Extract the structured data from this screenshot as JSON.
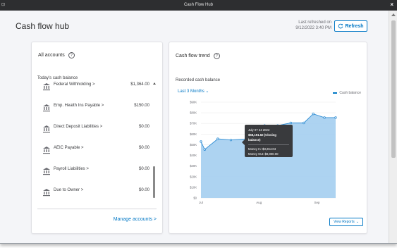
{
  "window": {
    "title": "Cash Flow Hub",
    "left_icon": "⊡",
    "close_icon": "×"
  },
  "header": {
    "page_title": "Cash flow hub",
    "last_refreshed_label": "Last refreshed on",
    "last_refreshed_value": "9/12/2022 3:40 PM",
    "refresh_label": "Refresh",
    "refresh_icon": "refresh-icon"
  },
  "accounts_card": {
    "title": "All accounts",
    "help_icon": "?",
    "section_label": "Today's cash balance",
    "accounts": [
      {
        "name": "Federal Withholding",
        "chevron": ">",
        "amount": "$1,364.00"
      },
      {
        "name": "Emp. Health Ins Payable",
        "chevron": ">",
        "amount": "$150.00"
      },
      {
        "name": "Direct Deposit Liabilities",
        "chevron": ">",
        "amount": "$0.00"
      },
      {
        "name": "AEIC Payable",
        "chevron": ">",
        "amount": "$0.00"
      },
      {
        "name": "Payroll Liabilities",
        "chevron": ">",
        "amount": "$0.00"
      },
      {
        "name": "Due to Owner",
        "chevron": ">",
        "amount": "$0.00"
      }
    ],
    "account_icon": "bank-icon",
    "manage_link": "Manage accounts >"
  },
  "trend_card": {
    "title": "Cash flow trend",
    "help_icon": "?",
    "recorded_label": "Recorded cash balance",
    "period_select": "Last 3 Months",
    "legend_label": "Cash balance",
    "view_reports": "View Reports",
    "tooltip": {
      "date": "July 07 24 2022",
      "balance_line": "$58,191.62 (Closing balance)",
      "money_in": "Money In: $3,264.04",
      "money_out": "Money Out: $8,800.00"
    },
    "colors": {
      "accent": "#0077c5",
      "area_fill": "#a9d1f0",
      "line": "#2d8cd3",
      "tooltip_bg": "#393a3d"
    }
  },
  "chart_data": {
    "type": "area",
    "title": "",
    "ylabel": "",
    "xlabel": "",
    "ylim": [
      0,
      90000
    ],
    "yticks": [
      "$0",
      "$10K",
      "$20K",
      "$30K",
      "$40K",
      "$50K",
      "$60K",
      "$70K",
      "$80K",
      "$90K"
    ],
    "xticks": [
      {
        "label": "Jul",
        "x": 0
      },
      {
        "label": "Aug",
        "x": 31
      },
      {
        "label": "Sep",
        "x": 62
      }
    ],
    "grid": true,
    "series": [
      {
        "name": "Cash balance",
        "x": [
          0,
          2,
          9,
          16,
          25,
          29,
          34,
          41,
          48,
          55,
          60,
          66,
          72
        ],
        "values": [
          53000,
          45500,
          55500,
          54500,
          55500,
          65500,
          68000,
          68000,
          70500,
          70500,
          79000,
          75500,
          75500
        ]
      }
    ]
  }
}
